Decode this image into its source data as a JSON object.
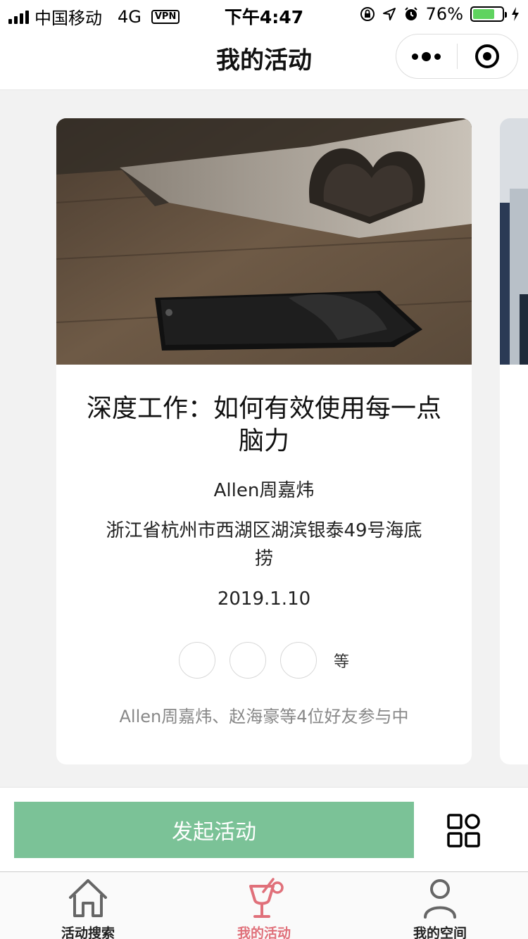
{
  "status_bar": {
    "carrier": "中国移动",
    "network": "4G",
    "vpn": "VPN",
    "time": "下午4:47",
    "battery_percent": "76%",
    "battery_level": 0.76
  },
  "nav": {
    "title": "我的活动"
  },
  "card": {
    "title": "深度工作：如何有效使用每一点脑力",
    "author": "Allen周嘉炜",
    "address": "浙江省杭州市西湖区湖滨银泰49号海底捞",
    "date": "2019.1.10",
    "etc_label": "等",
    "friends_text": "Allen周嘉炜、赵海豪等4位好友参与中"
  },
  "actions": {
    "launch_label": "发起活动"
  },
  "tabbar": {
    "items": [
      {
        "label": "活动搜索",
        "icon": "house-icon",
        "active": false
      },
      {
        "label": "我的活动",
        "icon": "cocktail-icon",
        "active": true
      },
      {
        "label": "我的空间",
        "icon": "person-icon",
        "active": false
      }
    ]
  },
  "colors": {
    "accent_green": "#7bc297",
    "active_tab": "#e0707a",
    "battery_green": "#5fd35f"
  }
}
